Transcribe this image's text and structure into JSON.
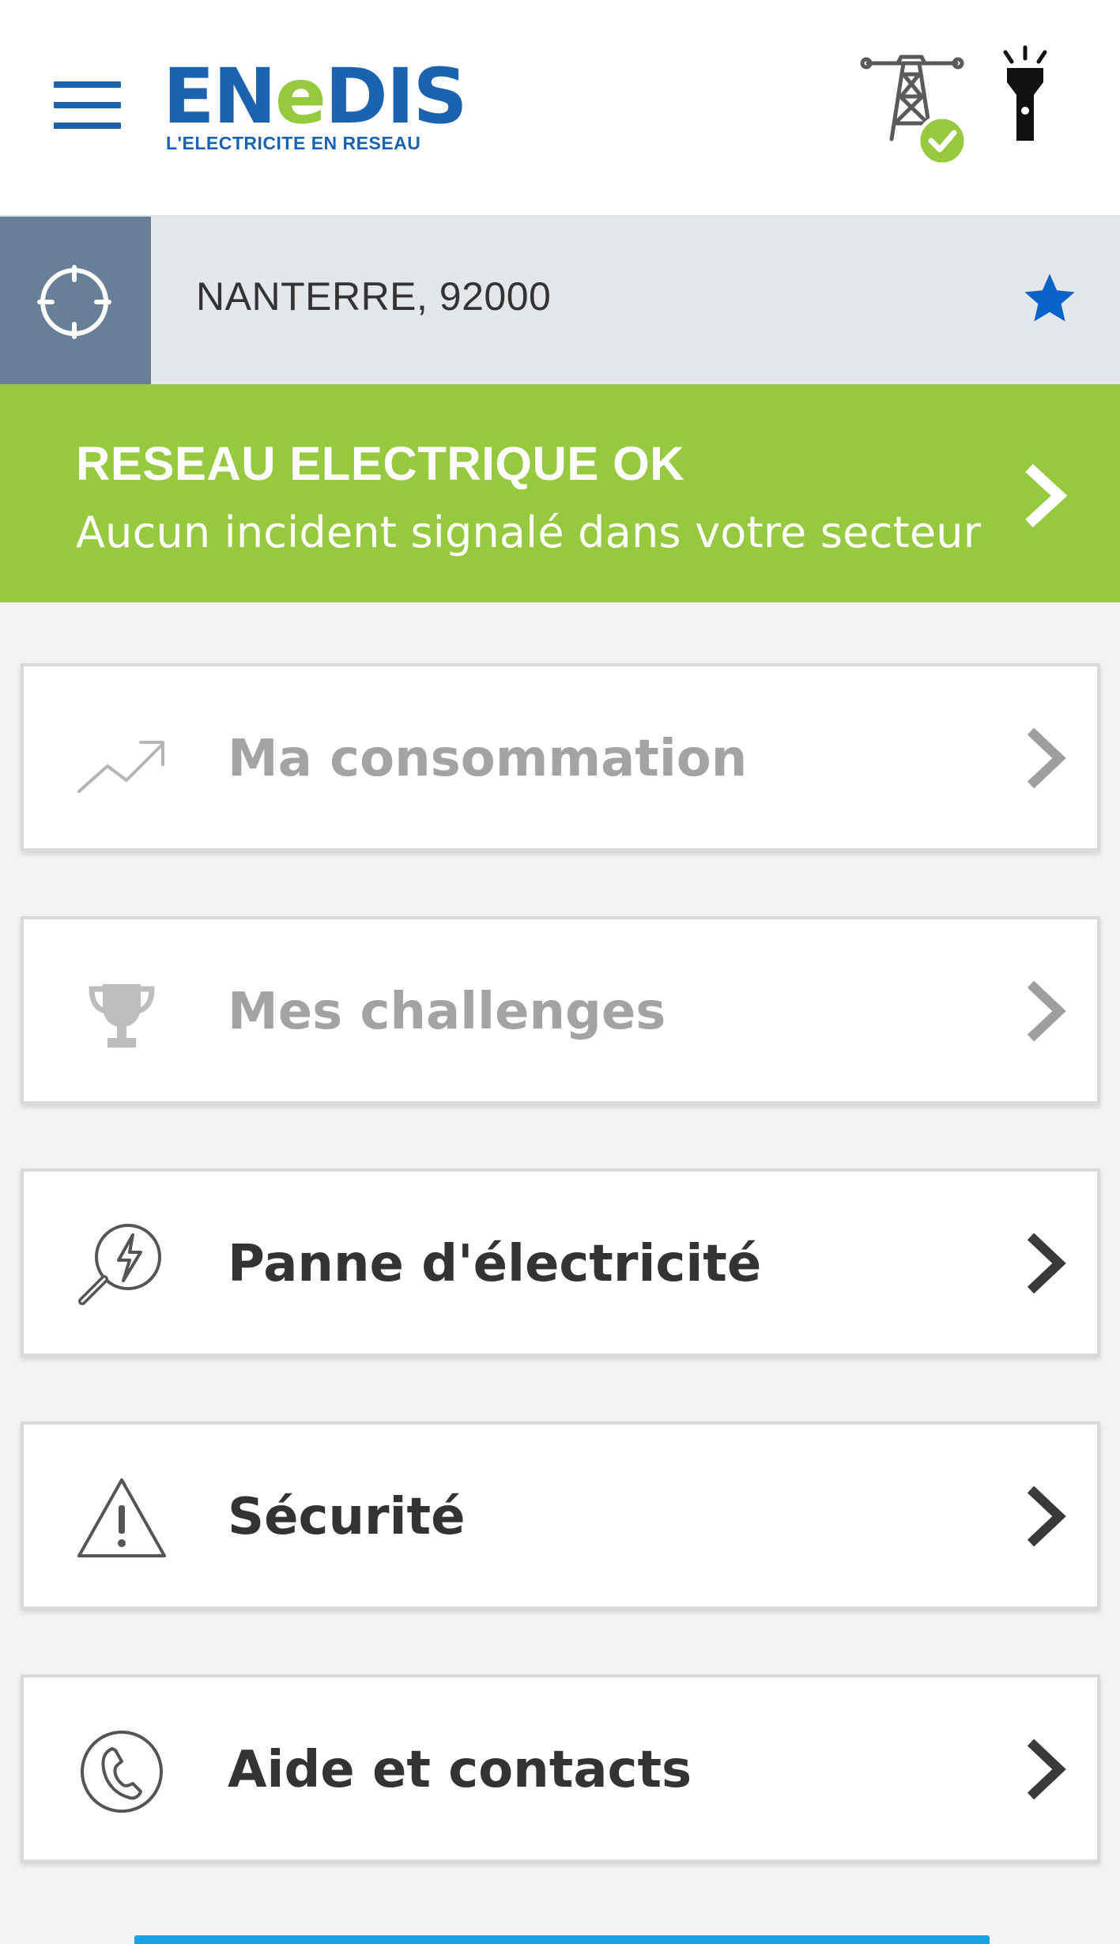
{
  "header": {
    "logo_word_a": "EN",
    "logo_word_b": "e",
    "logo_word_c": "DIS",
    "logo_tagline": "L'ELECTRICITE EN RESEAU",
    "icons": [
      "menu-icon",
      "pylon-status-icon",
      "torch-icon"
    ]
  },
  "location": {
    "text": "NANTERRE, 92000",
    "icons": [
      "locate-icon",
      "favorite-star-icon"
    ]
  },
  "status": {
    "title": "RESEAU ELECTRIQUE OK",
    "subtitle": "Aucun incident signalé dans votre secteur",
    "color": "#96c93d"
  },
  "menu": {
    "items": [
      {
        "label": "Ma consommation",
        "icon": "trend-up-icon",
        "enabled": false
      },
      {
        "label": "Mes challenges",
        "icon": "trophy-icon",
        "enabled": false
      },
      {
        "label": "Panne d'électricité",
        "icon": "power-outage-search-icon",
        "enabled": true
      },
      {
        "label": "Sécurité",
        "icon": "warning-triangle-icon",
        "enabled": true
      },
      {
        "label": "Aide et contacts",
        "icon": "phone-icon",
        "enabled": true
      }
    ]
  },
  "colors": {
    "brand_blue": "#1b63b0",
    "brand_green": "#96c93d",
    "locate_bg": "#687f96",
    "star": "#0a63c8"
  }
}
